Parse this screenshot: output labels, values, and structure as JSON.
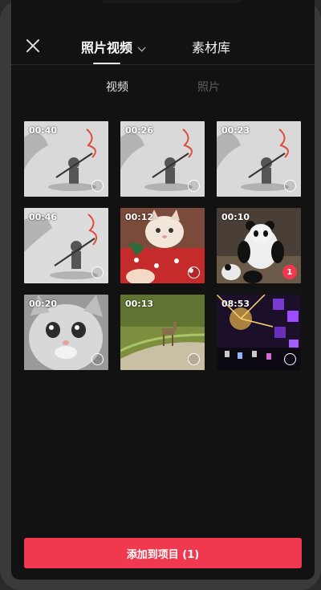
{
  "header": {
    "tab_active": "照片视频",
    "tab_library": "素材库"
  },
  "subtabs": {
    "video": "视频",
    "photo": "照片"
  },
  "media": [
    {
      "duration": "00:40",
      "name": "wukong-video-1",
      "selected": false
    },
    {
      "duration": "00:26",
      "name": "wukong-video-2",
      "selected": false
    },
    {
      "duration": "00:23",
      "name": "wukong-video-3",
      "selected": false
    },
    {
      "duration": "00:46",
      "name": "wukong-video-4",
      "selected": false
    },
    {
      "duration": "00:12",
      "name": "kitten-christmas-video",
      "selected": false
    },
    {
      "duration": "00:10",
      "name": "panda-video",
      "selected": true,
      "selection_index": "1"
    },
    {
      "duration": "00:20",
      "name": "cat-closeup-video",
      "selected": false
    },
    {
      "duration": "00:13",
      "name": "deer-grass-video",
      "selected": false
    },
    {
      "duration": "08:53",
      "name": "concert-lights-video",
      "selected": false
    }
  ],
  "footer": {
    "add_button_label": "添加到项目 (1)"
  },
  "colors": {
    "accent": "#f0394f",
    "background": "#121212"
  }
}
